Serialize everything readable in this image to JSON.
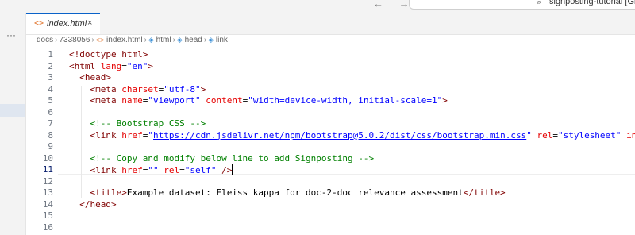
{
  "window": {
    "nav_arrows": "← →",
    "search_text": "signposting-tutorial [Git",
    "search_icon": "search-icon"
  },
  "activity": {
    "more": "···"
  },
  "tab": {
    "label": "index.html",
    "close": "×",
    "icon": "html-file-icon"
  },
  "breadcrumb": [
    "docs",
    "7338056",
    "index.html",
    "html",
    "head",
    "link"
  ],
  "editor": {
    "active_line": 11,
    "line_numbers": [
      "1",
      "2",
      "3",
      "4",
      "5",
      "6",
      "7",
      "8",
      "9",
      "10",
      "11",
      "12",
      "13",
      "14",
      "15",
      "16"
    ],
    "lines": [
      [
        [
          "tag",
          "<!doctype html>"
        ]
      ],
      [
        [
          "tag",
          "<html "
        ],
        [
          "attr",
          "lang"
        ],
        [
          "txt",
          "="
        ],
        [
          "str",
          "\"en\""
        ],
        [
          "tag",
          ">"
        ]
      ],
      [
        [
          "txt",
          "  "
        ],
        [
          "tag",
          "<head>"
        ]
      ],
      [
        [
          "txt",
          "    "
        ],
        [
          "tag",
          "<meta "
        ],
        [
          "attr",
          "charset"
        ],
        [
          "txt",
          "="
        ],
        [
          "str",
          "\"utf-8\""
        ],
        [
          "tag",
          ">"
        ]
      ],
      [
        [
          "txt",
          "    "
        ],
        [
          "tag",
          "<meta "
        ],
        [
          "attr",
          "name"
        ],
        [
          "txt",
          "="
        ],
        [
          "str",
          "\"viewport\""
        ],
        [
          "txt",
          " "
        ],
        [
          "attr",
          "content"
        ],
        [
          "txt",
          "="
        ],
        [
          "str",
          "\"width=device-width, initial-scale=1\""
        ],
        [
          "tag",
          ">"
        ]
      ],
      [],
      [
        [
          "txt",
          "    "
        ],
        [
          "comment",
          "<!-- Bootstrap CSS -->"
        ]
      ],
      [
        [
          "txt",
          "    "
        ],
        [
          "tag",
          "<link "
        ],
        [
          "attr",
          "href"
        ],
        [
          "txt",
          "="
        ],
        [
          "str",
          "\""
        ],
        [
          "link",
          "https://cdn.jsdelivr.net/npm/bootstrap@5.0.2/dist/css/bootstrap.min.css"
        ],
        [
          "str",
          "\""
        ],
        [
          "txt",
          " "
        ],
        [
          "attr",
          "rel"
        ],
        [
          "txt",
          "="
        ],
        [
          "str",
          "\"stylesheet\""
        ],
        [
          "txt",
          " "
        ],
        [
          "attr",
          "inte"
        ]
      ],
      [],
      [
        [
          "txt",
          "    "
        ],
        [
          "comment",
          "<!-- Copy and modify below line to add Signposting -->"
        ]
      ],
      [
        [
          "txt",
          "    "
        ],
        [
          "tag",
          "<link "
        ],
        [
          "attr",
          "href"
        ],
        [
          "txt",
          "="
        ],
        [
          "str",
          "\"\""
        ],
        [
          "txt",
          " "
        ],
        [
          "attr",
          "rel"
        ],
        [
          "txt",
          "="
        ],
        [
          "str",
          "\"self\""
        ],
        [
          "txt",
          " "
        ],
        [
          "tag",
          "/>"
        ]
      ],
      [],
      [
        [
          "txt",
          "    "
        ],
        [
          "tag",
          "<title>"
        ],
        [
          "txt",
          "Example dataset: Fleiss kappa for doc-2-doc relevance assessment"
        ],
        [
          "tag",
          "</title>"
        ]
      ],
      [
        [
          "txt",
          "  "
        ],
        [
          "tag",
          "</head>"
        ]
      ],
      [],
      []
    ]
  }
}
